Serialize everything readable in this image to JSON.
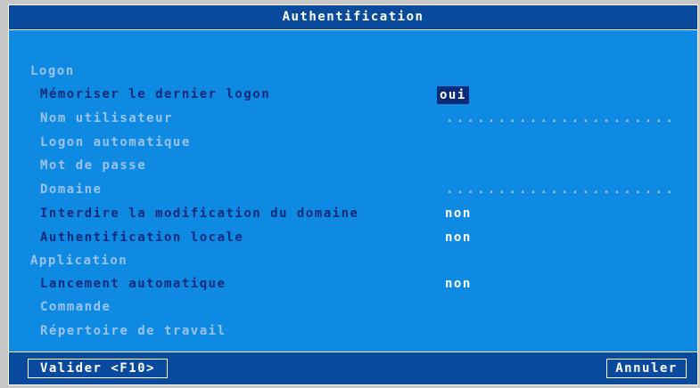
{
  "dialog": {
    "title": "Authentification"
  },
  "sections": {
    "logon": "Logon",
    "application": "Application"
  },
  "fields": {
    "memoriser": {
      "label": "Mémoriser le dernier logon",
      "value": "oui"
    },
    "nom_utilisateur": {
      "label": "Nom utilisateur",
      "value": "......................"
    },
    "logon_auto": {
      "label": "Logon automatique"
    },
    "mot_de_passe": {
      "label": "Mot de passe"
    },
    "domaine": {
      "label": "Domaine",
      "value": "......................"
    },
    "interdire": {
      "label": "Interdire la modification du domaine",
      "value": "non"
    },
    "auth_locale": {
      "label": "Authentification locale",
      "value": "non"
    },
    "lancement": {
      "label": "Lancement automatique",
      "value": "non"
    },
    "commande": {
      "label": "Commande"
    },
    "repertoire": {
      "label": "Répertoire de travail"
    }
  },
  "buttons": {
    "valider": "Valider <F10>",
    "annuler": "Annuler"
  },
  "colors": {
    "panel": "#0f8ae3",
    "titlebar": "#0a4a9c",
    "active_text": "#0a2a7a",
    "dim_text": "#9ac4ee"
  }
}
